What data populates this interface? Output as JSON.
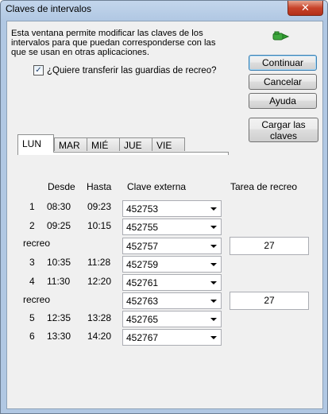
{
  "window": {
    "title": "Claves de intervalos"
  },
  "description": "Esta ventana permite modificar las claves de los intervalos para que puedan corresponderse con las que se usan en otras aplicaciones.",
  "transfer_checkbox": {
    "label": "¿Quiere transferir las guardias de recreo?",
    "checked": true
  },
  "buttons": {
    "continuar": "Continuar",
    "cancelar": "Cancelar",
    "ayuda": "Ayuda",
    "cargar": "Cargar las claves"
  },
  "icons": {
    "link": "green-link-icon",
    "close": "close-icon"
  },
  "tabs": [
    "LUN",
    "MAR",
    "MIÉ",
    "JUE",
    "VIE"
  ],
  "active_tab": "LUN",
  "table": {
    "headers": {
      "desde": "Desde",
      "hasta": "Hasta",
      "clave": "Clave externa",
      "tarea": "Tarea de recreo"
    },
    "rows": [
      {
        "num": "1",
        "desde": "08:30",
        "hasta": "09:23",
        "clave": "452753"
      },
      {
        "num": "2",
        "desde": "09:25",
        "hasta": "10:15",
        "clave": "452755"
      },
      {
        "label": "recreo",
        "clave": "452757",
        "tarea": "27"
      },
      {
        "num": "3",
        "desde": "10:35",
        "hasta": "11:28",
        "clave": "452759"
      },
      {
        "num": "4",
        "desde": "11:30",
        "hasta": "12:20",
        "clave": "452761"
      },
      {
        "label": "recreo",
        "clave": "452763",
        "tarea": "27"
      },
      {
        "num": "5",
        "desde": "12:35",
        "hasta": "13:28",
        "clave": "452765"
      },
      {
        "num": "6",
        "desde": "13:30",
        "hasta": "14:20",
        "clave": "452767"
      }
    ]
  },
  "colors": {
    "accent": "#3c7fb1",
    "close_button": "#c7432a",
    "link_icon": "#2e9e2e"
  }
}
